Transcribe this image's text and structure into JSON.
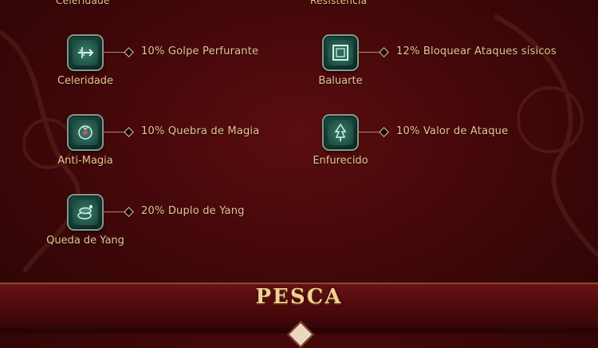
{
  "top_cut_labels": {
    "left": "Celeridade",
    "right": "Resistência"
  },
  "skills": [
    {
      "icon": "crossed-swords-icon",
      "name": "Celeridade",
      "description": "10% Golpe Perfurante"
    },
    {
      "icon": "square-shield-icon",
      "name": "Baluarte",
      "description": "12% Bloquear Ataques sísicos"
    },
    {
      "icon": "heart-flower-icon",
      "name": "Anti-Magia",
      "description": "10% Quebra de Magia"
    },
    {
      "icon": "tree-fist-icon",
      "name": "Enfurecido",
      "description": "10% Valor de Ataque"
    },
    {
      "icon": "yang-coins-icon",
      "name": "Queda de Yang",
      "description": "20% Duplo de Yang"
    }
  ],
  "section_banner": {
    "title": "PESCA"
  },
  "colors": {
    "background": "#3f0709",
    "text_gold": "#e9c794",
    "icon_teal": "#1d4a40",
    "icon_border": "#7f9e90"
  }
}
